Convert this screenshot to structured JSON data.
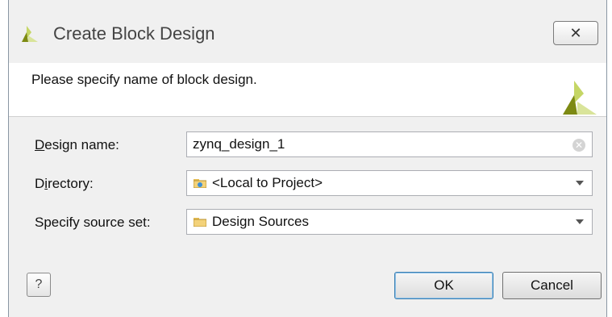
{
  "window": {
    "title": "Create Block Design",
    "close_symbol": "✕"
  },
  "header": {
    "message": "Please specify name of block design."
  },
  "form": {
    "design_name": {
      "label_mnemonic": "D",
      "label_rest": "esign name:",
      "value": "zynq_design_1"
    },
    "directory": {
      "label_pre": "D",
      "label_mnemonic": "i",
      "label_rest": "rectory:",
      "value": "<Local to Project>",
      "icon": "project-folder-icon"
    },
    "source_set": {
      "label": "Specify source set:",
      "value": "Design Sources",
      "icon": "folder-icon"
    }
  },
  "buttons": {
    "help": "?",
    "ok": "OK",
    "cancel": "Cancel"
  },
  "colors": {
    "logo_light": "#c5d665",
    "logo_dark": "#7d8a13",
    "ok_border": "#3c7fb1"
  }
}
